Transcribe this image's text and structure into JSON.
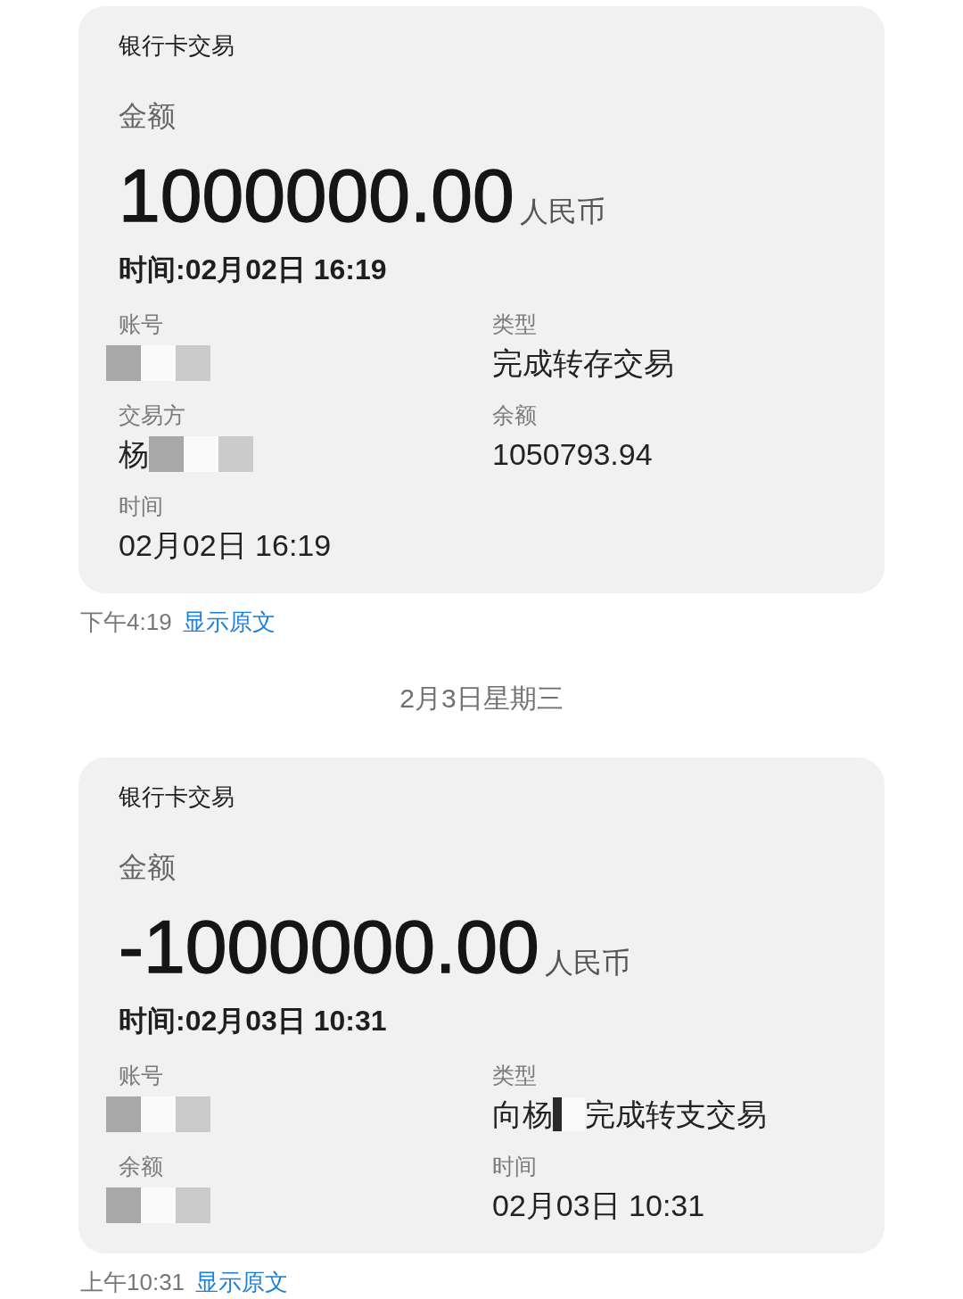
{
  "messages": [
    {
      "kind": "card",
      "title": "银行卡交易",
      "amount_label": "金额",
      "amount": "1000000.00",
      "currency": "人民币",
      "time_line": "时间:02月02日 16:19",
      "fields": [
        {
          "label": "账号",
          "value": [
            {
              "kind": "redaction"
            }
          ]
        },
        {
          "label": "类型",
          "value": [
            {
              "kind": "text",
              "text": "完成转存交易"
            }
          ]
        },
        {
          "label": "交易方",
          "value": [
            {
              "kind": "text",
              "text": "杨"
            },
            {
              "kind": "redaction"
            }
          ]
        },
        {
          "label": "余额",
          "value": [
            {
              "kind": "text",
              "text": "1050793.94"
            }
          ]
        },
        {
          "label": "时间",
          "value": [
            {
              "kind": "text",
              "text": "02月02日 16:19"
            }
          ]
        }
      ],
      "footer": {
        "time": "下午4:19",
        "link": "显示原文"
      }
    },
    {
      "kind": "date",
      "text": "2月3日星期三"
    },
    {
      "kind": "card",
      "title": "银行卡交易",
      "amount_label": "金额",
      "amount": "-1000000.00",
      "currency": "人民币",
      "time_line": "时间:02月03日 10:31",
      "fields": [
        {
          "label": "账号",
          "value": [
            {
              "kind": "redaction"
            }
          ]
        },
        {
          "label": "类型",
          "value": [
            {
              "kind": "text",
              "text": "向杨"
            },
            {
              "kind": "redaction"
            },
            {
              "kind": "text",
              "text": "完成转支交易"
            }
          ]
        },
        {
          "label": "余额",
          "value": [
            {
              "kind": "redaction"
            }
          ]
        },
        {
          "label": "时间",
          "value": [
            {
              "kind": "text",
              "text": "02月03日 10:31"
            }
          ]
        }
      ],
      "footer": {
        "time": "上午10:31",
        "link": "显示原文"
      }
    }
  ]
}
